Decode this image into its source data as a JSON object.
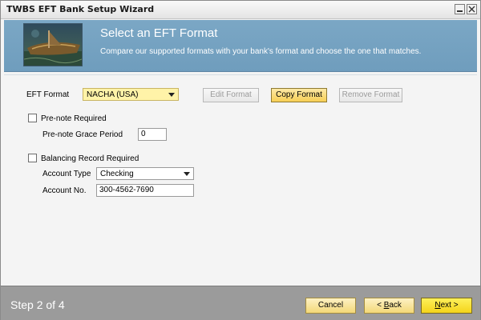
{
  "window": {
    "title": "TWBS EFT Bank Setup Wizard",
    "minimize_icon": "minimize-icon",
    "close_icon": "close-icon"
  },
  "header": {
    "title": "Select an EFT Format",
    "description": "Compare our supported formats with your bank's format and choose the one that matches.",
    "logo": "boat-image"
  },
  "eft": {
    "label": "EFT Format",
    "selected": "NACHA (USA)",
    "edit_label": "Edit Format",
    "copy_label": "Copy Format",
    "remove_label": "Remove Format"
  },
  "prenote": {
    "checkbox_label": "Pre-note Required",
    "checked": false,
    "grace_label": "Pre-note Grace Period",
    "grace_value": "0"
  },
  "balancing": {
    "checkbox_label": "Balancing Record Required",
    "checked": false,
    "account_type_label": "Account Type",
    "account_type_value": "Checking",
    "account_no_label": "Account No.",
    "account_no_value": "300-4562-7690"
  },
  "footer": {
    "step_text": "Step 2 of 4",
    "cancel_label": "Cancel",
    "back_prefix": "< ",
    "back_mnemonic": "B",
    "back_rest": "ack",
    "next_mnemonic": "N",
    "next_rest": "ext >"
  },
  "colors": {
    "header_bg": "#7ba7c5",
    "footer_bg": "#9b9b9b",
    "eft_combo_bg": "#fff3a8",
    "next_button_bg": "#f4d41a"
  }
}
